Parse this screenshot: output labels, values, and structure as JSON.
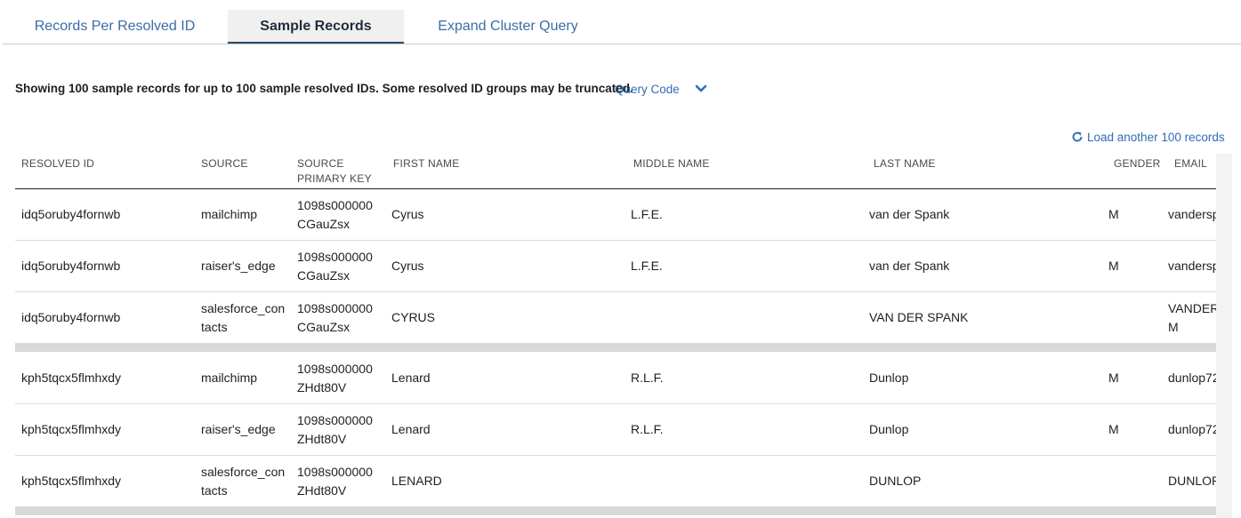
{
  "tabs": [
    {
      "label": "Records Per Resolved ID",
      "active": false
    },
    {
      "label": "Sample Records",
      "active": true
    },
    {
      "label": "Expand Cluster Query",
      "active": false
    }
  ],
  "summary": "Showing 100 sample records for up to 100 sample resolved IDs. Some resolved ID groups may be truncated.",
  "query_code_label": "Query Code",
  "load_more_label": "Load another 100 records",
  "colors": {
    "accent": "#2f6db5",
    "tab_active_bg": "#f0f0f0",
    "group_separator": "#d9d9d9"
  },
  "icons": {
    "query_toggle": "chevron-down-icon",
    "load_more": "refresh-icon"
  },
  "table": {
    "headers": {
      "resolved_id": "RESOLVED ID",
      "source": "SOURCE",
      "source_pk_1": "SOURCE",
      "source_pk_2": "PRIMARY KEY",
      "first_name": "FIRST NAME",
      "middle_name": "MIDDLE NAME",
      "last_name": "LAST NAME",
      "gender": "GENDER",
      "email": "EMAIL"
    },
    "rows": [
      {
        "resolved_id": "idq5oruby4fornwb",
        "source_1": "mailchimp",
        "source_2": "",
        "pk_1": "1098s000000",
        "pk_2": "CGauZsx",
        "first_name": "Cyrus",
        "middle_name": "L.F.E.",
        "last_name": "van der Spank",
        "gender": "M",
        "email_1": "vandersp",
        "email_2": ""
      },
      {
        "resolved_id": "idq5oruby4fornwb",
        "source_1": "raiser's_edge",
        "source_2": "",
        "pk_1": "1098s000000",
        "pk_2": "CGauZsx",
        "first_name": "Cyrus",
        "middle_name": "L.F.E.",
        "last_name": "van der Spank",
        "gender": "M",
        "email_1": "vandersp",
        "email_2": ""
      },
      {
        "resolved_id": "idq5oruby4fornwb",
        "source_1": "salesforce_con",
        "source_2": "tacts",
        "pk_1": "1098s000000",
        "pk_2": "CGauZsx",
        "first_name": "CYRUS",
        "middle_name": "",
        "last_name": "VAN DER SPANK",
        "gender": "",
        "email_1": "VANDER",
        "email_2": "M"
      },
      {
        "resolved_id": "kph5tqcx5flmhxdy",
        "source_1": "mailchimp",
        "source_2": "",
        "pk_1": "1098s000000",
        "pk_2": "ZHdt80V",
        "first_name": "Lenard",
        "middle_name": "R.L.F.",
        "last_name": "Dunlop",
        "gender": "M",
        "email_1": "dunlop72",
        "email_2": ""
      },
      {
        "resolved_id": "kph5tqcx5flmhxdy",
        "source_1": "raiser's_edge",
        "source_2": "",
        "pk_1": "1098s000000",
        "pk_2": "ZHdt80V",
        "first_name": "Lenard",
        "middle_name": "R.L.F.",
        "last_name": "Dunlop",
        "gender": "M",
        "email_1": "dunlop72",
        "email_2": ""
      },
      {
        "resolved_id": "kph5tqcx5flmhxdy",
        "source_1": "salesforce_con",
        "source_2": "tacts",
        "pk_1": "1098s000000",
        "pk_2": "ZHdt80V",
        "first_name": "LENARD",
        "middle_name": "",
        "last_name": "DUNLOP",
        "gender": "",
        "email_1": "DUNLOP",
        "email_2": ""
      }
    ]
  }
}
